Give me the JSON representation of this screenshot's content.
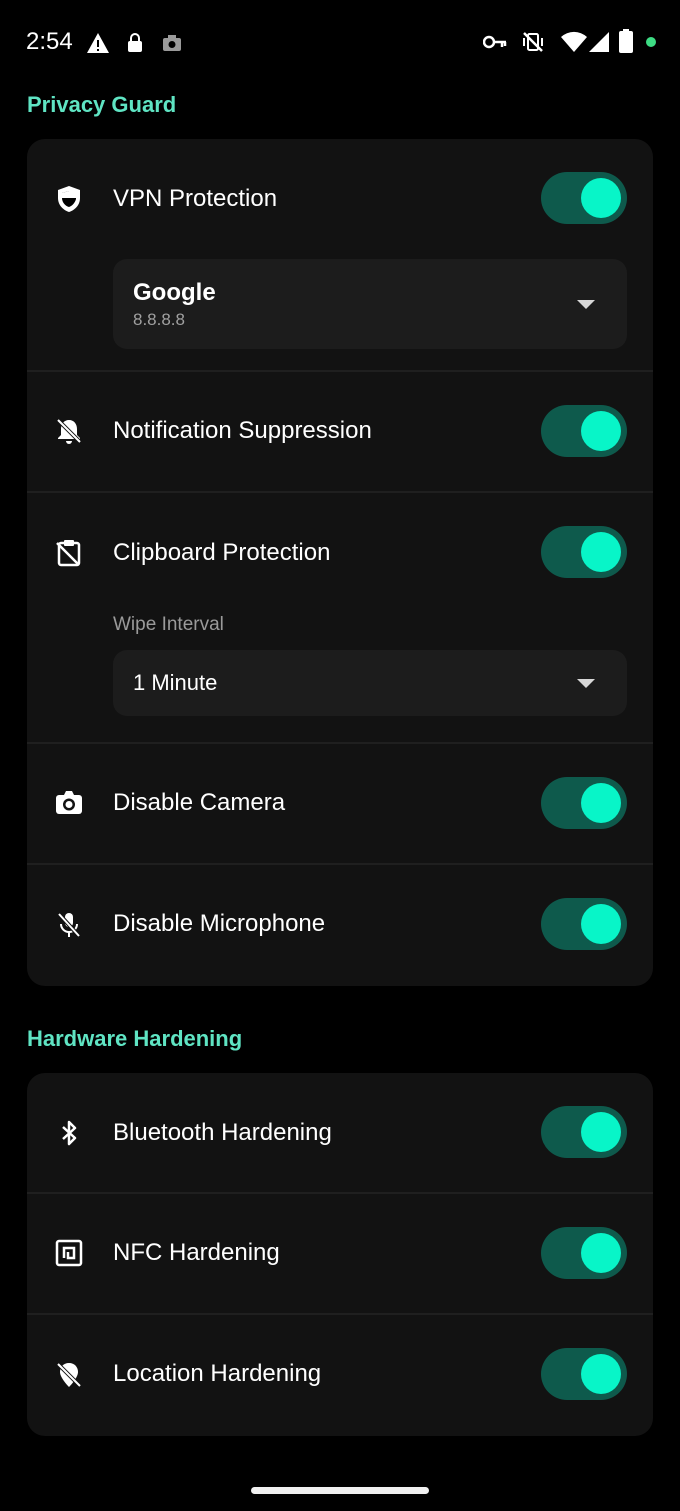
{
  "status_bar": {
    "time": "2:54",
    "left_icons": [
      "warning-icon",
      "lock-icon",
      "camera-icon"
    ],
    "right_icons": [
      "key-icon",
      "vibrate-off-icon",
      "wifi-icon",
      "signal-icon",
      "battery-icon",
      "dot-icon"
    ],
    "dot_color": "#3ddc84"
  },
  "colors": {
    "accent": "#5fe4c3",
    "toggle_track": "#0e5a4c",
    "toggle_knob": "#08f5c8",
    "card": "#121212"
  },
  "privacy_guard": {
    "title": "Privacy Guard",
    "vpn": {
      "label": "VPN Protection",
      "icon": "shield-icon",
      "enabled": true,
      "dns_provider": "Google",
      "dns_address": "8.8.8.8"
    },
    "notification": {
      "label": "Notification Suppression",
      "icon": "bell-off-icon",
      "enabled": true
    },
    "clipboard": {
      "label": "Clipboard Protection",
      "icon": "clipboard-off-icon",
      "enabled": true,
      "wipe_interval_label": "Wipe Interval",
      "wipe_interval_value": "1 Minute"
    },
    "camera": {
      "label": "Disable Camera",
      "icon": "camera-icon",
      "enabled": true
    },
    "microphone": {
      "label": "Disable Microphone",
      "icon": "mic-off-icon",
      "enabled": true
    }
  },
  "hardware_hardening": {
    "title": "Hardware Hardening",
    "bluetooth": {
      "label": "Bluetooth Hardening",
      "icon": "bluetooth-icon",
      "enabled": true
    },
    "nfc": {
      "label": "NFC Hardening",
      "icon": "nfc-icon",
      "enabled": true
    },
    "location": {
      "label": "Location Hardening",
      "icon": "location-off-icon",
      "enabled": true
    }
  }
}
